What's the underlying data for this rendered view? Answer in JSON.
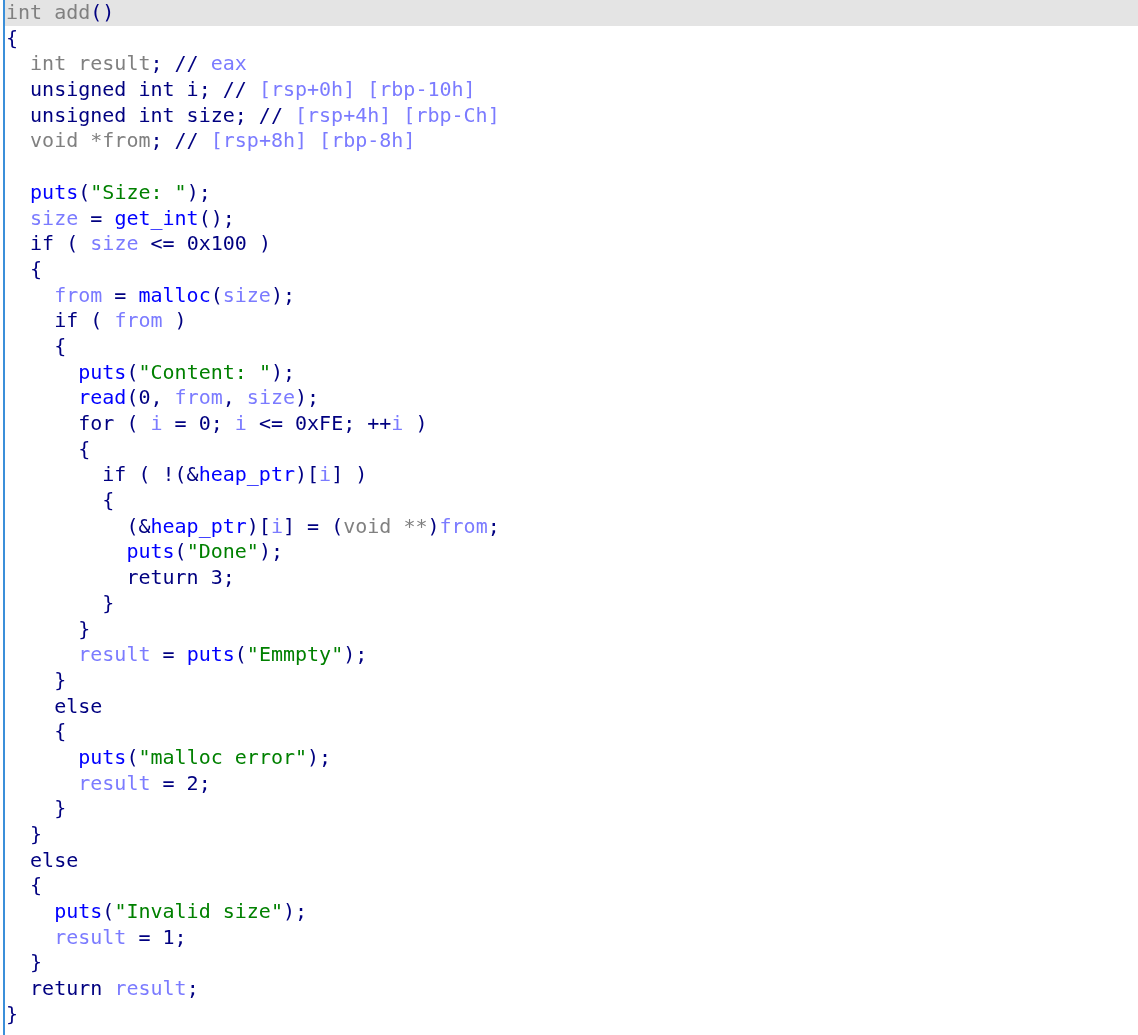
{
  "lines": [
    {
      "selected": true,
      "tokens": [
        {
          "kind": "type",
          "text": "int add"
        },
        {
          "kind": "plain",
          "text": "()"
        }
      ]
    },
    {
      "selected": false,
      "tokens": [
        {
          "kind": "plain",
          "text": "{"
        }
      ]
    },
    {
      "selected": false,
      "tokens": [
        {
          "kind": "type",
          "text": "  int result"
        },
        {
          "kind": "plain",
          "text": "; // "
        },
        {
          "kind": "var",
          "text": "eax"
        }
      ]
    },
    {
      "selected": false,
      "tokens": [
        {
          "kind": "plain",
          "text": "  unsigned int i; // "
        },
        {
          "kind": "var",
          "text": "[rsp+0h] [rbp-10h]"
        }
      ]
    },
    {
      "selected": false,
      "tokens": [
        {
          "kind": "plain",
          "text": "  unsigned int size; // "
        },
        {
          "kind": "var",
          "text": "[rsp+4h] [rbp-Ch]"
        }
      ]
    },
    {
      "selected": false,
      "tokens": [
        {
          "kind": "type",
          "text": "  void *from"
        },
        {
          "kind": "plain",
          "text": "; // "
        },
        {
          "kind": "var",
          "text": "[rsp+8h] [rbp-8h]"
        }
      ]
    },
    {
      "selected": false
    },
    {
      "selected": false,
      "tokens": [
        {
          "kind": "func",
          "text": "  puts"
        },
        {
          "kind": "plain",
          "text": "("
        },
        {
          "kind": "string",
          "text": "\"Size: \""
        },
        {
          "kind": "plain",
          "text": ");"
        }
      ]
    },
    {
      "selected": false,
      "tokens": [
        {
          "kind": "var",
          "text": "  size"
        },
        {
          "kind": "plain",
          "text": " = "
        },
        {
          "kind": "func",
          "text": "get_int"
        },
        {
          "kind": "plain",
          "text": "();"
        }
      ]
    },
    {
      "selected": false,
      "tokens": [
        {
          "kind": "plain",
          "text": "  if ( "
        },
        {
          "kind": "var",
          "text": "size"
        },
        {
          "kind": "plain",
          "text": " <= 0x100 )"
        }
      ]
    },
    {
      "selected": false,
      "tokens": [
        {
          "kind": "plain",
          "text": "  {"
        }
      ]
    },
    {
      "selected": false,
      "tokens": [
        {
          "kind": "var",
          "text": "    from"
        },
        {
          "kind": "plain",
          "text": " = "
        },
        {
          "kind": "func",
          "text": "malloc"
        },
        {
          "kind": "plain",
          "text": "("
        },
        {
          "kind": "var",
          "text": "size"
        },
        {
          "kind": "plain",
          "text": ");"
        }
      ]
    },
    {
      "selected": false,
      "tokens": [
        {
          "kind": "plain",
          "text": "    if ( "
        },
        {
          "kind": "var",
          "text": "from"
        },
        {
          "kind": "plain",
          "text": " )"
        }
      ]
    },
    {
      "selected": false,
      "tokens": [
        {
          "kind": "plain",
          "text": "    {"
        }
      ]
    },
    {
      "selected": false,
      "tokens": [
        {
          "kind": "func",
          "text": "      puts"
        },
        {
          "kind": "plain",
          "text": "("
        },
        {
          "kind": "string",
          "text": "\"Content: \""
        },
        {
          "kind": "plain",
          "text": ");"
        }
      ]
    },
    {
      "selected": false,
      "tokens": [
        {
          "kind": "func",
          "text": "      read"
        },
        {
          "kind": "plain",
          "text": "(0, "
        },
        {
          "kind": "var",
          "text": "from"
        },
        {
          "kind": "plain",
          "text": ", "
        },
        {
          "kind": "var",
          "text": "size"
        },
        {
          "kind": "plain",
          "text": ");"
        }
      ]
    },
    {
      "selected": false,
      "tokens": [
        {
          "kind": "plain",
          "text": "      for ( "
        },
        {
          "kind": "var",
          "text": "i"
        },
        {
          "kind": "plain",
          "text": " = 0; "
        },
        {
          "kind": "var",
          "text": "i"
        },
        {
          "kind": "plain",
          "text": " <= 0xFE; ++"
        },
        {
          "kind": "var",
          "text": "i"
        },
        {
          "kind": "plain",
          "text": " )"
        }
      ]
    },
    {
      "selected": false,
      "tokens": [
        {
          "kind": "plain",
          "text": "      {"
        }
      ]
    },
    {
      "selected": false,
      "tokens": [
        {
          "kind": "plain",
          "text": "        if ( !(&"
        },
        {
          "kind": "func",
          "text": "heap_ptr"
        },
        {
          "kind": "plain",
          "text": ")["
        },
        {
          "kind": "var",
          "text": "i"
        },
        {
          "kind": "plain",
          "text": "] )"
        }
      ]
    },
    {
      "selected": false,
      "tokens": [
        {
          "kind": "plain",
          "text": "        {"
        }
      ]
    },
    {
      "selected": false,
      "tokens": [
        {
          "kind": "plain",
          "text": "          (&"
        },
        {
          "kind": "func",
          "text": "heap_ptr"
        },
        {
          "kind": "plain",
          "text": ")["
        },
        {
          "kind": "var",
          "text": "i"
        },
        {
          "kind": "plain",
          "text": "] = ("
        },
        {
          "kind": "type",
          "text": "void **"
        },
        {
          "kind": "plain",
          "text": ")"
        },
        {
          "kind": "var",
          "text": "from"
        },
        {
          "kind": "plain",
          "text": ";"
        }
      ]
    },
    {
      "selected": false,
      "tokens": [
        {
          "kind": "func",
          "text": "          puts"
        },
        {
          "kind": "plain",
          "text": "("
        },
        {
          "kind": "string",
          "text": "\"Done\""
        },
        {
          "kind": "plain",
          "text": ");"
        }
      ]
    },
    {
      "selected": false,
      "tokens": [
        {
          "kind": "plain",
          "text": "          return 3;"
        }
      ]
    },
    {
      "selected": false,
      "tokens": [
        {
          "kind": "plain",
          "text": "        }"
        }
      ]
    },
    {
      "selected": false,
      "tokens": [
        {
          "kind": "plain",
          "text": "      }"
        }
      ]
    },
    {
      "selected": false,
      "tokens": [
        {
          "kind": "var",
          "text": "      result"
        },
        {
          "kind": "plain",
          "text": " = "
        },
        {
          "kind": "func",
          "text": "puts"
        },
        {
          "kind": "plain",
          "text": "("
        },
        {
          "kind": "string",
          "text": "\"Emmpty\""
        },
        {
          "kind": "plain",
          "text": ");"
        }
      ]
    },
    {
      "selected": false,
      "tokens": [
        {
          "kind": "plain",
          "text": "    }"
        }
      ]
    },
    {
      "selected": false,
      "tokens": [
        {
          "kind": "plain",
          "text": "    else"
        }
      ]
    },
    {
      "selected": false,
      "tokens": [
        {
          "kind": "plain",
          "text": "    {"
        }
      ]
    },
    {
      "selected": false,
      "tokens": [
        {
          "kind": "func",
          "text": "      puts"
        },
        {
          "kind": "plain",
          "text": "("
        },
        {
          "kind": "string",
          "text": "\"malloc error\""
        },
        {
          "kind": "plain",
          "text": ");"
        }
      ]
    },
    {
      "selected": false,
      "tokens": [
        {
          "kind": "var",
          "text": "      result"
        },
        {
          "kind": "plain",
          "text": " = 2;"
        }
      ]
    },
    {
      "selected": false,
      "tokens": [
        {
          "kind": "plain",
          "text": "    }"
        }
      ]
    },
    {
      "selected": false,
      "tokens": [
        {
          "kind": "plain",
          "text": "  }"
        }
      ]
    },
    {
      "selected": false,
      "tokens": [
        {
          "kind": "plain",
          "text": "  else"
        }
      ]
    },
    {
      "selected": false,
      "tokens": [
        {
          "kind": "plain",
          "text": "  {"
        }
      ]
    },
    {
      "selected": false,
      "tokens": [
        {
          "kind": "func",
          "text": "    puts"
        },
        {
          "kind": "plain",
          "text": "("
        },
        {
          "kind": "string",
          "text": "\"Invalid size\""
        },
        {
          "kind": "plain",
          "text": ");"
        }
      ]
    },
    {
      "selected": false,
      "tokens": [
        {
          "kind": "var",
          "text": "    result"
        },
        {
          "kind": "plain",
          "text": " = 1;"
        }
      ]
    },
    {
      "selected": false,
      "tokens": [
        {
          "kind": "plain",
          "text": "  }"
        }
      ]
    },
    {
      "selected": false,
      "tokens": [
        {
          "kind": "plain",
          "text": "  return "
        },
        {
          "kind": "var",
          "text": "result"
        },
        {
          "kind": "plain",
          "text": ";"
        }
      ]
    },
    {
      "selected": false,
      "tokens": [
        {
          "kind": "plain",
          "text": "}"
        }
      ]
    }
  ]
}
